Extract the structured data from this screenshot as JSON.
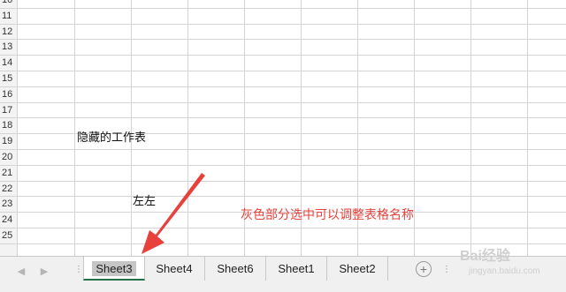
{
  "rows": [
    "10",
    "11",
    "12",
    "13",
    "14",
    "15",
    "16",
    "17",
    "18",
    "19",
    "20",
    "21",
    "22",
    "23",
    "24",
    "25"
  ],
  "cells": {
    "hidden_sheets_label": "隐藏的工作表",
    "left_label": "左左"
  },
  "annotation": {
    "text": "灰色部分选中可以调整表格名称",
    "color": "#e8413b"
  },
  "sheet_tabs": [
    {
      "label": "Sheet3",
      "active": true
    },
    {
      "label": "Sheet4",
      "active": false
    },
    {
      "label": "Sheet6",
      "active": false
    },
    {
      "label": "Sheet1",
      "active": false
    },
    {
      "label": "Sheet2",
      "active": false
    }
  ],
  "tabbar": {
    "prev_icon": "caret-left-icon",
    "next_icon": "caret-right-icon",
    "add_icon": "plus-circle-icon",
    "add_glyph": "+",
    "more_dots": "⋮"
  },
  "watermark": {
    "text": "Bai经验",
    "subtext": "jingyan.baidu.com"
  },
  "colors": {
    "active_tab_underline": "#217346",
    "selection_gray": "#c6c6c6",
    "arrow": "#e8413b"
  }
}
